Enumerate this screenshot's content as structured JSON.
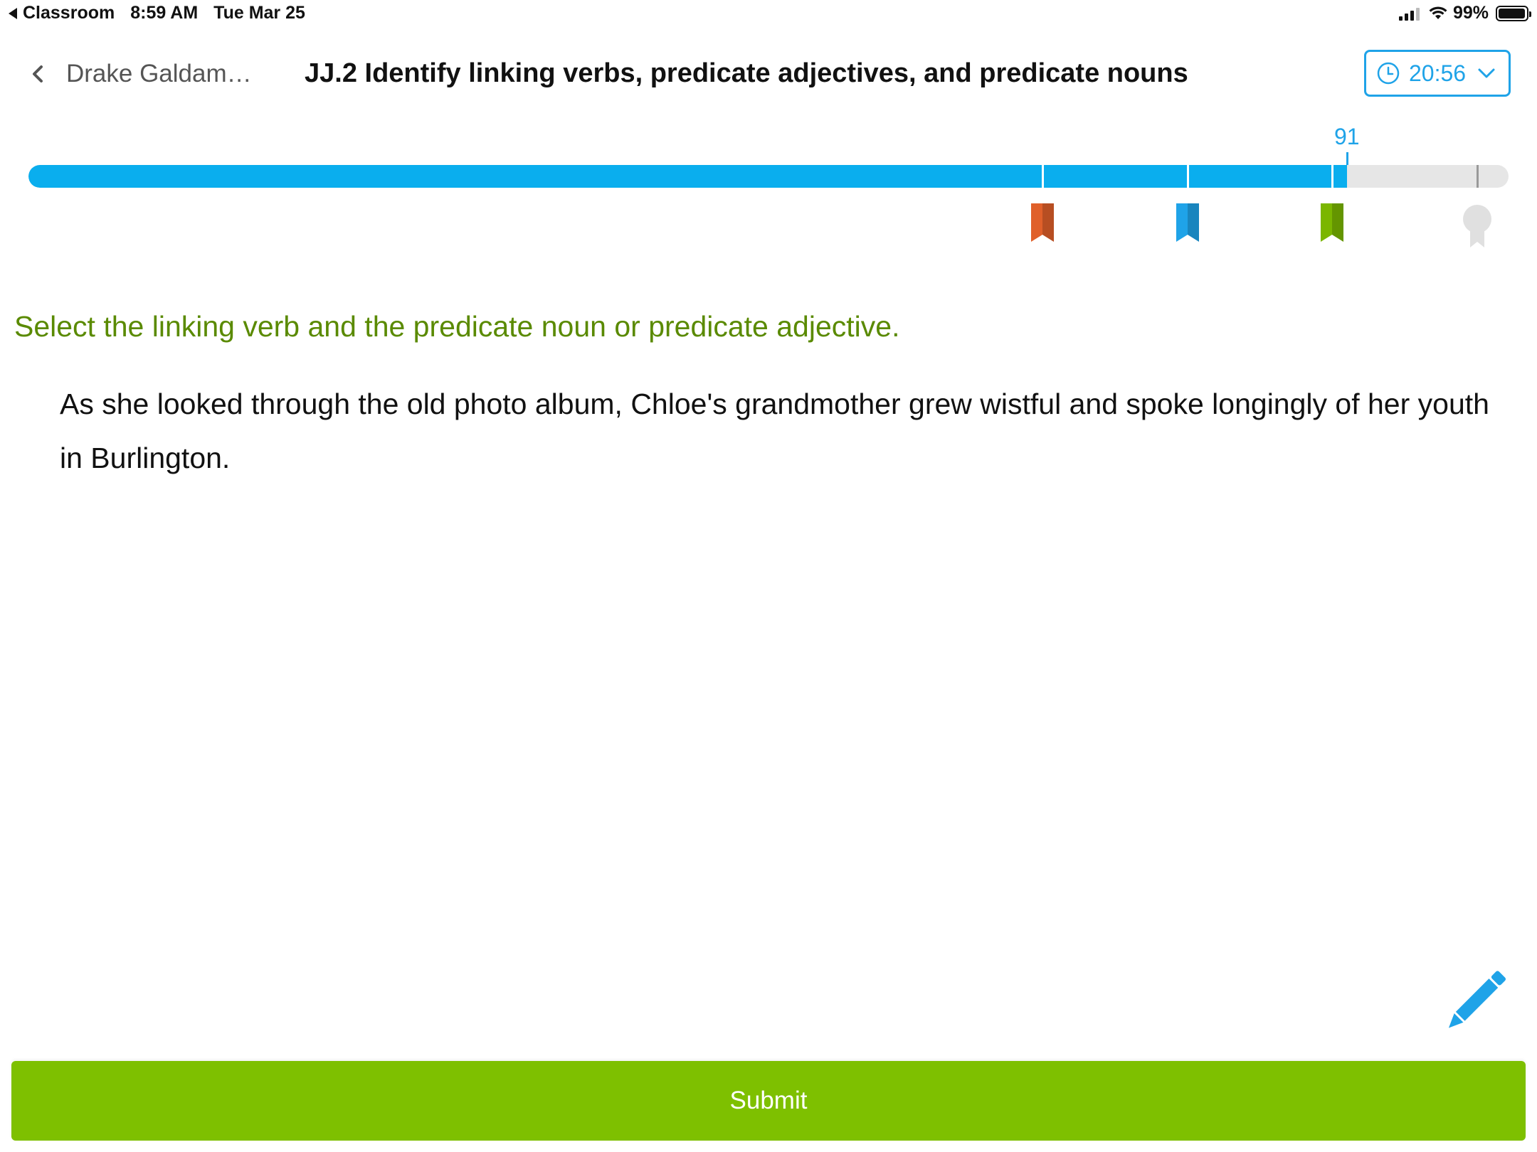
{
  "status_bar": {
    "back_app": "Classroom",
    "time": "8:59 AM",
    "date": "Tue Mar 25",
    "battery": "99%",
    "icons": [
      "signal-icon",
      "wifi-icon",
      "battery-icon"
    ]
  },
  "header": {
    "student_name": "Drake Galdam…",
    "title": "JJ.2 Identify linking verbs, predicate adjectives, and predicate nouns",
    "timer": "20:56",
    "icons": [
      "back-chevron-icon",
      "clock-icon",
      "chevron-down-icon"
    ]
  },
  "progress": {
    "score": "91",
    "score_value": 91,
    "max": 100,
    "milestones": [
      {
        "value": 70,
        "color": "#e0602a",
        "icon": "orange-ribbon-icon"
      },
      {
        "value": 80,
        "color": "#1fa3e8",
        "icon": "blue-ribbon-icon"
      },
      {
        "value": 90,
        "color": "#7bb600",
        "icon": "green-ribbon-icon"
      },
      {
        "value": 100,
        "color": "#e0e0e0",
        "icon": "award-icon"
      }
    ]
  },
  "question": {
    "instruction": "Select the linking verb and the predicate noun or predicate adjective.",
    "sentence": "As she looked through the old photo album, Chloe's grandmother grew wistful and spoke longingly of her youth in Burlington."
  },
  "tools": {
    "pencil_icon": "pencil-icon"
  },
  "footer": {
    "submit_label": "Submit"
  },
  "colors": {
    "accent_blue": "#0aaeee",
    "instruction_green": "#5a8a00",
    "submit_green": "#7ec000"
  }
}
